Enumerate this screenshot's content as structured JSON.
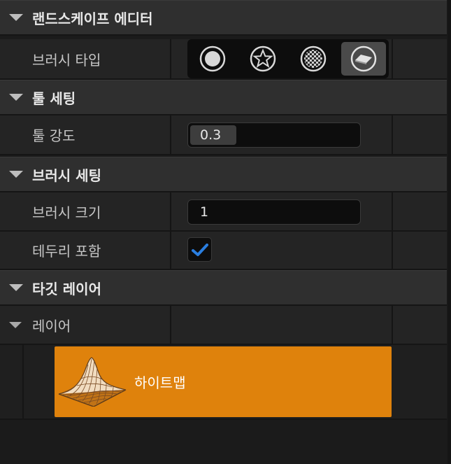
{
  "sections": {
    "landscape_editor": "랜드스케이프 에디터",
    "tool_settings": "툴 세팅",
    "brush_settings": "브러시 세팅",
    "target_layer": "타깃 레이어"
  },
  "rows": {
    "brush_type_label": "브러시 타입",
    "tool_strength_label": "툴 강도",
    "tool_strength_value": "0.3",
    "brush_size_label": "브러시 크기",
    "brush_size_value": "1",
    "include_edge_label": "테두리 포함",
    "include_edge_checked": true,
    "layer_label": "레이어"
  },
  "brush_types": [
    {
      "icon": "circle-brush-icon",
      "selected": false
    },
    {
      "icon": "star-brush-icon",
      "selected": false
    },
    {
      "icon": "pattern-brush-icon",
      "selected": false
    },
    {
      "icon": "component-brush-icon",
      "selected": true
    }
  ],
  "layers": [
    {
      "name": "하이트맵",
      "icon": "heightmap-icon",
      "selected": true
    }
  ],
  "colors": {
    "accent_orange": "#df820c",
    "check_blue": "#2a7ee0"
  }
}
